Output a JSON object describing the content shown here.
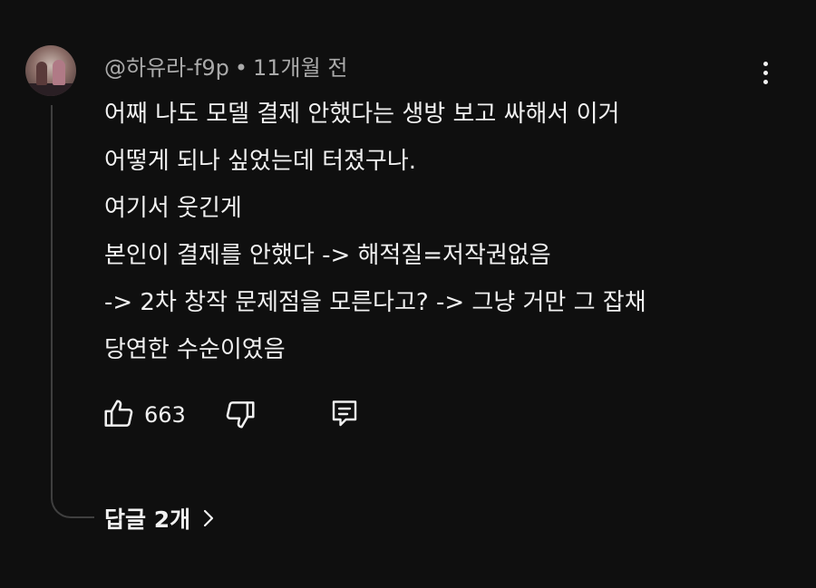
{
  "comment": {
    "author": "@하유라-f9p",
    "separator": "•",
    "time": "11개월 전",
    "lines": [
      "어째 나도 모델 결제 안했다는 생방 보고 싸해서 이거",
      "어떻게 되나 싶었는데 터졌구나.",
      "여기서 웃긴게",
      "본인이 결제를 안했다 -> 해적질=저작권없음",
      "-> 2차 창작 문제점을 모른다고? -> 그냥 거만 그 잡채",
      "당연한 수순이였음"
    ],
    "like_count": "663",
    "replies_label": "답글 2개"
  },
  "icons": {
    "like": "thumbs-up-icon",
    "dislike": "thumbs-down-icon",
    "reply": "comment-icon",
    "more": "more-vertical-icon",
    "replies_chevron": "chevron-right-icon"
  }
}
